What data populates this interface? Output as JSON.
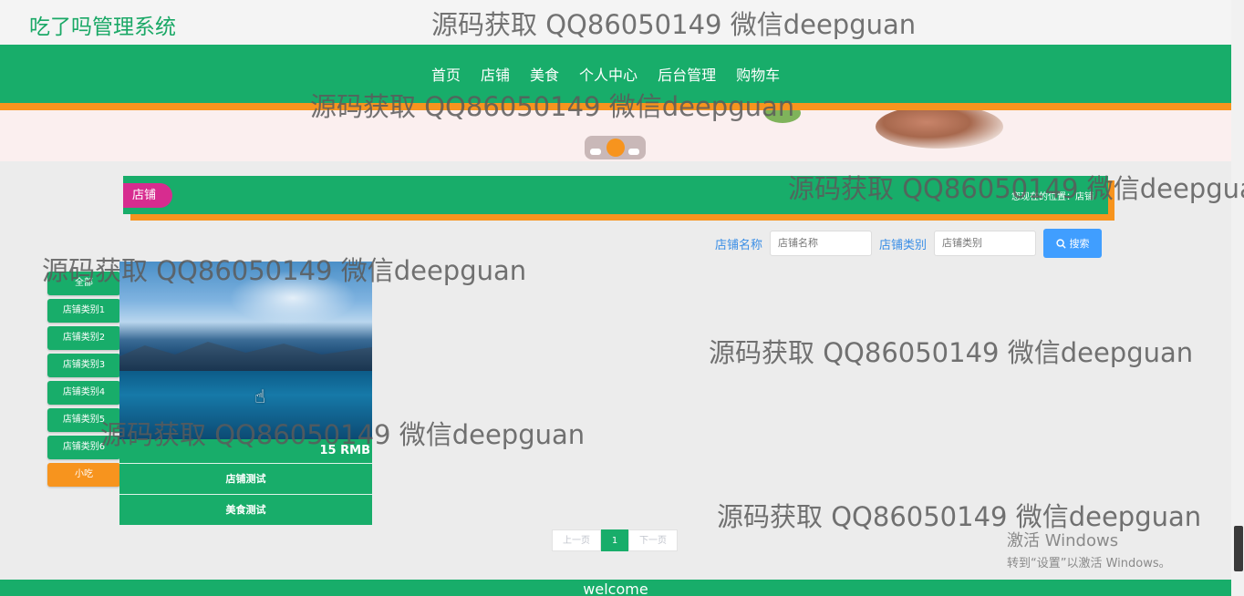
{
  "app": {
    "logo": "吃了吗管理系统"
  },
  "nav": {
    "items": [
      "首页",
      "店铺",
      "美食",
      "个人中心",
      "后台管理",
      "购物车"
    ]
  },
  "section": {
    "tag": "店铺",
    "location": "您现在的位置：店铺"
  },
  "search": {
    "shop_name_label": "店铺名称",
    "shop_name_placeholder": "店铺名称",
    "shop_type_label": "店铺类别",
    "shop_type_placeholder": "店铺类别",
    "button_label": "搜索"
  },
  "categories": [
    "全部",
    "店铺类别1",
    "店铺类别2",
    "店铺类别3",
    "店铺类别4",
    "店铺类别5",
    "店铺类别6",
    "小吃"
  ],
  "card": {
    "price": "15 RMB",
    "shop_link": "店铺测试",
    "food_link": "美食测试"
  },
  "pager": {
    "prev": "上一页",
    "page": "1",
    "next": "下一页"
  },
  "footer": {
    "text": "welcome"
  },
  "watermark": "源码获取 QQ86050149 微信deepguan",
  "windows": {
    "line1": "激活 Windows",
    "line2": "转到“设置”以激活 Windows。"
  },
  "colors": {
    "primary": "#18ad6a",
    "accent": "#f7941e",
    "tag": "#d72c8f",
    "button": "#409eff"
  }
}
